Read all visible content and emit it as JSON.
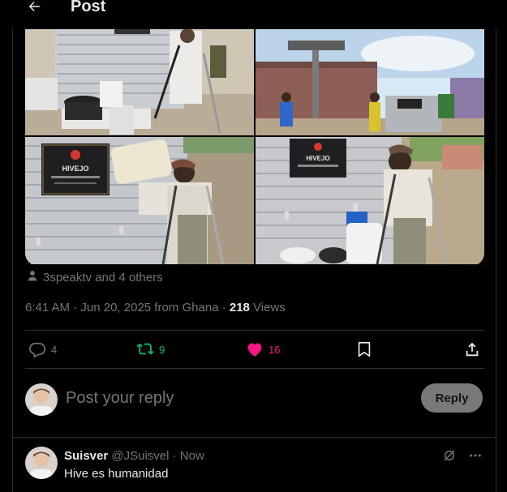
{
  "header": {
    "back_icon": "arrow-left-icon",
    "title": "Post"
  },
  "media": {
    "photos": [
      {
        "name": "photo-1"
      },
      {
        "name": "photo-2"
      },
      {
        "name": "photo-3",
        "sign_title": "HIVEJO"
      },
      {
        "name": "photo-4",
        "sign_title": "HIVEJO"
      }
    ]
  },
  "tagged": {
    "icon": "person-icon",
    "text": "3speaktv and 4 others"
  },
  "meta": {
    "time": "6:41 AM",
    "dot1": " · ",
    "date": "Jun 20, 2025 from Ghana",
    "dot2": " · ",
    "views_count": "218",
    "views_label": " Views"
  },
  "actions": {
    "reply_count": "4",
    "repost_count": "9",
    "like_count": "16",
    "colors": {
      "muted": "#71767b",
      "repost": "#00ba7c",
      "like": "#f91880"
    }
  },
  "composer": {
    "placeholder": "Post your reply",
    "button_label": "Reply"
  },
  "reply": {
    "name": "Suisver",
    "handle": "@JSuisvel · Now",
    "text": "Hive es humanidad"
  }
}
